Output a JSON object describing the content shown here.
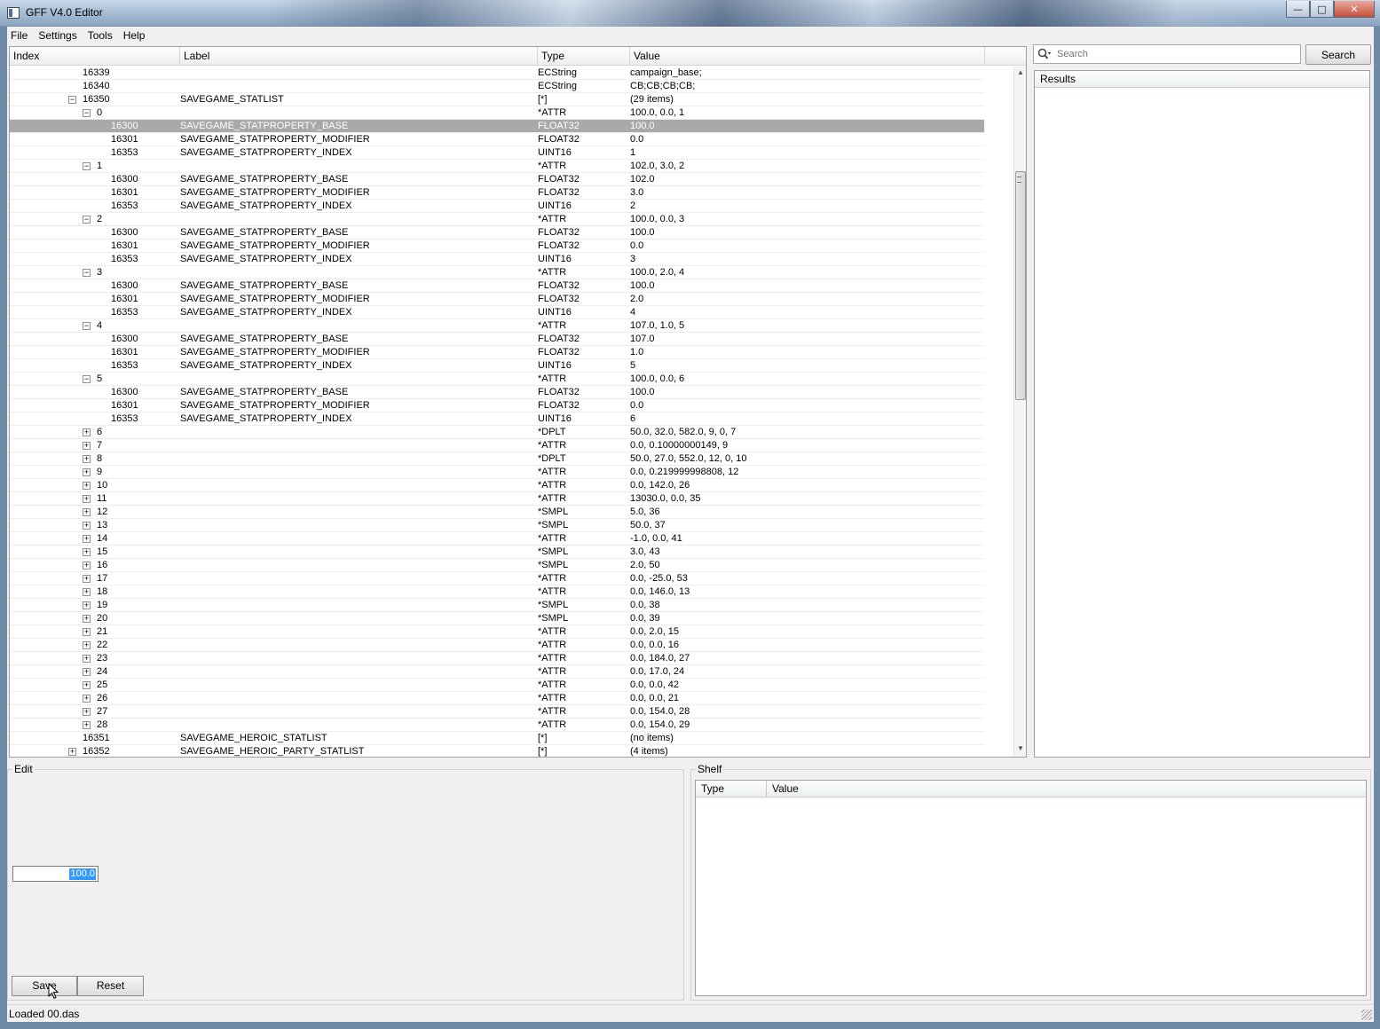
{
  "window": {
    "title": "GFF V4.0 Editor",
    "buttons": [
      "—",
      "□",
      "✕"
    ]
  },
  "menu": [
    "File",
    "Settings",
    "Tools",
    "Help"
  ],
  "tree": {
    "columns": [
      "Index",
      "Label",
      "Type",
      "Value"
    ],
    "selected_row": 4,
    "rows": [
      {
        "indent": 0,
        "exp": "",
        "index": "16339",
        "label": "",
        "type": "ECString",
        "value": "campaign_base;"
      },
      {
        "indent": 0,
        "exp": "",
        "index": "16340",
        "label": "",
        "type": "ECString",
        "value": "CB;CB;CB;CB;"
      },
      {
        "indent": 0,
        "exp": "minus",
        "index": "16350",
        "label": "SAVEGAME_STATLIST",
        "type": "[*]",
        "value": "(29 items)"
      },
      {
        "indent": 1,
        "exp": "minus",
        "index": "0",
        "label": "",
        "type": "*ATTR",
        "value": "100.0, 0.0, 1"
      },
      {
        "indent": 2,
        "exp": "",
        "index": "16300",
        "label": "SAVEGAME_STATPROPERTY_BASE",
        "type": "FLOAT32",
        "value": "100.0"
      },
      {
        "indent": 2,
        "exp": "",
        "index": "16301",
        "label": "SAVEGAME_STATPROPERTY_MODIFIER",
        "type": "FLOAT32",
        "value": "0.0"
      },
      {
        "indent": 2,
        "exp": "",
        "index": "16353",
        "label": "SAVEGAME_STATPROPERTY_INDEX",
        "type": "UINT16",
        "value": "1"
      },
      {
        "indent": 1,
        "exp": "minus",
        "index": "1",
        "label": "",
        "type": "*ATTR",
        "value": "102.0, 3.0, 2"
      },
      {
        "indent": 2,
        "exp": "",
        "index": "16300",
        "label": "SAVEGAME_STATPROPERTY_BASE",
        "type": "FLOAT32",
        "value": "102.0"
      },
      {
        "indent": 2,
        "exp": "",
        "index": "16301",
        "label": "SAVEGAME_STATPROPERTY_MODIFIER",
        "type": "FLOAT32",
        "value": "3.0"
      },
      {
        "indent": 2,
        "exp": "",
        "index": "16353",
        "label": "SAVEGAME_STATPROPERTY_INDEX",
        "type": "UINT16",
        "value": "2"
      },
      {
        "indent": 1,
        "exp": "minus",
        "index": "2",
        "label": "",
        "type": "*ATTR",
        "value": "100.0, 0.0, 3"
      },
      {
        "indent": 2,
        "exp": "",
        "index": "16300",
        "label": "SAVEGAME_STATPROPERTY_BASE",
        "type": "FLOAT32",
        "value": "100.0"
      },
      {
        "indent": 2,
        "exp": "",
        "index": "16301",
        "label": "SAVEGAME_STATPROPERTY_MODIFIER",
        "type": "FLOAT32",
        "value": "0.0"
      },
      {
        "indent": 2,
        "exp": "",
        "index": "16353",
        "label": "SAVEGAME_STATPROPERTY_INDEX",
        "type": "UINT16",
        "value": "3"
      },
      {
        "indent": 1,
        "exp": "minus",
        "index": "3",
        "label": "",
        "type": "*ATTR",
        "value": "100.0, 2.0, 4"
      },
      {
        "indent": 2,
        "exp": "",
        "index": "16300",
        "label": "SAVEGAME_STATPROPERTY_BASE",
        "type": "FLOAT32",
        "value": "100.0"
      },
      {
        "indent": 2,
        "exp": "",
        "index": "16301",
        "label": "SAVEGAME_STATPROPERTY_MODIFIER",
        "type": "FLOAT32",
        "value": "2.0"
      },
      {
        "indent": 2,
        "exp": "",
        "index": "16353",
        "label": "SAVEGAME_STATPROPERTY_INDEX",
        "type": "UINT16",
        "value": "4"
      },
      {
        "indent": 1,
        "exp": "minus",
        "index": "4",
        "label": "",
        "type": "*ATTR",
        "value": "107.0, 1.0, 5"
      },
      {
        "indent": 2,
        "exp": "",
        "index": "16300",
        "label": "SAVEGAME_STATPROPERTY_BASE",
        "type": "FLOAT32",
        "value": "107.0"
      },
      {
        "indent": 2,
        "exp": "",
        "index": "16301",
        "label": "SAVEGAME_STATPROPERTY_MODIFIER",
        "type": "FLOAT32",
        "value": "1.0"
      },
      {
        "indent": 2,
        "exp": "",
        "index": "16353",
        "label": "SAVEGAME_STATPROPERTY_INDEX",
        "type": "UINT16",
        "value": "5"
      },
      {
        "indent": 1,
        "exp": "minus",
        "index": "5",
        "label": "",
        "type": "*ATTR",
        "value": "100.0, 0.0, 6"
      },
      {
        "indent": 2,
        "exp": "",
        "index": "16300",
        "label": "SAVEGAME_STATPROPERTY_BASE",
        "type": "FLOAT32",
        "value": "100.0"
      },
      {
        "indent": 2,
        "exp": "",
        "index": "16301",
        "label": "SAVEGAME_STATPROPERTY_MODIFIER",
        "type": "FLOAT32",
        "value": "0.0"
      },
      {
        "indent": 2,
        "exp": "",
        "index": "16353",
        "label": "SAVEGAME_STATPROPERTY_INDEX",
        "type": "UINT16",
        "value": "6"
      },
      {
        "indent": 1,
        "exp": "plus",
        "index": "6",
        "label": "",
        "type": "*DPLT",
        "value": "50.0, 32.0, 582.0, 9, 0, 7"
      },
      {
        "indent": 1,
        "exp": "plus",
        "index": "7",
        "label": "",
        "type": "*ATTR",
        "value": "0.0, 0.10000000149, 9"
      },
      {
        "indent": 1,
        "exp": "plus",
        "index": "8",
        "label": "",
        "type": "*DPLT",
        "value": "50.0, 27.0, 552.0, 12, 0, 10"
      },
      {
        "indent": 1,
        "exp": "plus",
        "index": "9",
        "label": "",
        "type": "*ATTR",
        "value": "0.0, 0.219999998808, 12"
      },
      {
        "indent": 1,
        "exp": "plus",
        "index": "10",
        "label": "",
        "type": "*ATTR",
        "value": "0.0, 142.0, 26"
      },
      {
        "indent": 1,
        "exp": "plus",
        "index": "11",
        "label": "",
        "type": "*ATTR",
        "value": "13030.0, 0.0, 35"
      },
      {
        "indent": 1,
        "exp": "plus",
        "index": "12",
        "label": "",
        "type": "*SMPL",
        "value": "5.0, 36"
      },
      {
        "indent": 1,
        "exp": "plus",
        "index": "13",
        "label": "",
        "type": "*SMPL",
        "value": "50.0, 37"
      },
      {
        "indent": 1,
        "exp": "plus",
        "index": "14",
        "label": "",
        "type": "*ATTR",
        "value": "-1.0, 0.0, 41"
      },
      {
        "indent": 1,
        "exp": "plus",
        "index": "15",
        "label": "",
        "type": "*SMPL",
        "value": "3.0, 43"
      },
      {
        "indent": 1,
        "exp": "plus",
        "index": "16",
        "label": "",
        "type": "*SMPL",
        "value": "2.0, 50"
      },
      {
        "indent": 1,
        "exp": "plus",
        "index": "17",
        "label": "",
        "type": "*ATTR",
        "value": "0.0, -25.0, 53"
      },
      {
        "indent": 1,
        "exp": "plus",
        "index": "18",
        "label": "",
        "type": "*ATTR",
        "value": "0.0, 146.0, 13"
      },
      {
        "indent": 1,
        "exp": "plus",
        "index": "19",
        "label": "",
        "type": "*SMPL",
        "value": "0.0, 38"
      },
      {
        "indent": 1,
        "exp": "plus",
        "index": "20",
        "label": "",
        "type": "*SMPL",
        "value": "0.0, 39"
      },
      {
        "indent": 1,
        "exp": "plus",
        "index": "21",
        "label": "",
        "type": "*ATTR",
        "value": "0.0, 2.0, 15"
      },
      {
        "indent": 1,
        "exp": "plus",
        "index": "22",
        "label": "",
        "type": "*ATTR",
        "value": "0.0, 0.0, 16"
      },
      {
        "indent": 1,
        "exp": "plus",
        "index": "23",
        "label": "",
        "type": "*ATTR",
        "value": "0.0, 184.0, 27"
      },
      {
        "indent": 1,
        "exp": "plus",
        "index": "24",
        "label": "",
        "type": "*ATTR",
        "value": "0.0, 17.0, 24"
      },
      {
        "indent": 1,
        "exp": "plus",
        "index": "25",
        "label": "",
        "type": "*ATTR",
        "value": "0.0, 0.0, 42"
      },
      {
        "indent": 1,
        "exp": "plus",
        "index": "26",
        "label": "",
        "type": "*ATTR",
        "value": "0.0, 0.0, 21"
      },
      {
        "indent": 1,
        "exp": "plus",
        "index": "27",
        "label": "",
        "type": "*ATTR",
        "value": "0.0, 154.0, 28"
      },
      {
        "indent": 1,
        "exp": "plus",
        "index": "28",
        "label": "",
        "type": "*ATTR",
        "value": "0.0, 154.0, 29"
      },
      {
        "indent": 0,
        "exp": "",
        "index": "16351",
        "label": "SAVEGAME_HEROIC_STATLIST",
        "type": "[*]",
        "value": "(no items)"
      },
      {
        "indent": 0,
        "exp": "plus",
        "index": "16352",
        "label": "SAVEGAME_HEROIC_PARTY_STATLIST",
        "type": "[*]",
        "value": "(4 items)"
      }
    ]
  },
  "search": {
    "placeholder": "Search",
    "button": "Search",
    "results_header": "Results"
  },
  "edit": {
    "title": "Edit",
    "value": "100.0",
    "save": "Save",
    "reset": "Reset"
  },
  "shelf": {
    "title": "Shelf",
    "columns": [
      "Type",
      "Value"
    ]
  },
  "status": {
    "text": "Loaded 00.das"
  }
}
